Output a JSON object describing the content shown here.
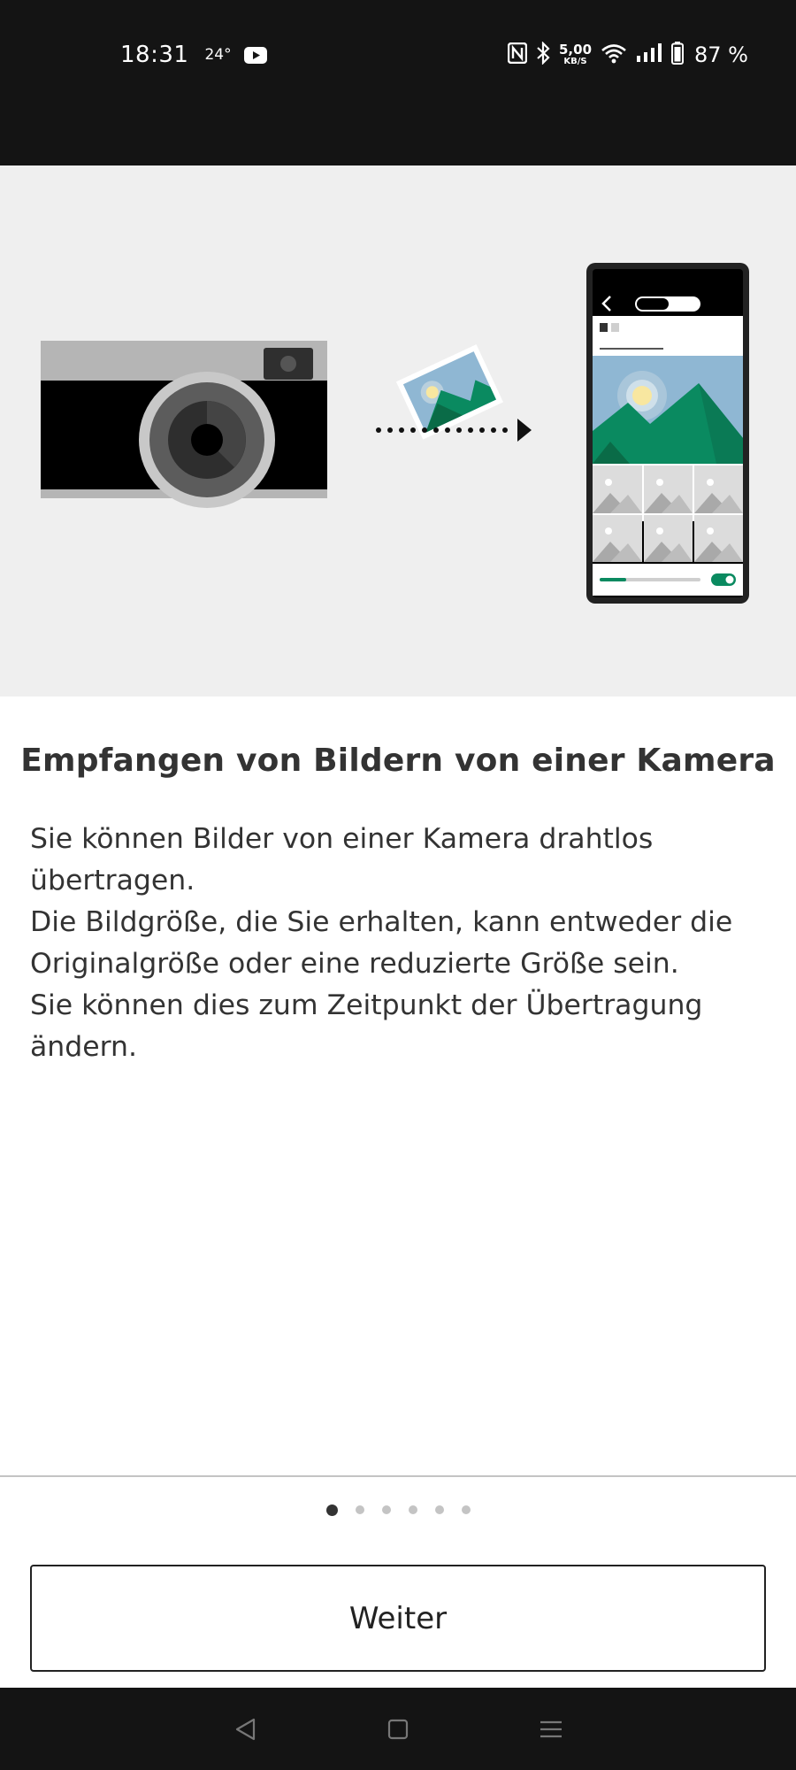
{
  "status_bar": {
    "time": "18:31",
    "temperature": "24°",
    "network_speed_value": "5,00",
    "network_speed_unit": "KB/S",
    "battery_percent": "87 %",
    "icons": [
      "youtube-icon",
      "nfc-icon",
      "bluetooth-icon",
      "wifi-icon",
      "signal-icon",
      "battery-icon"
    ]
  },
  "hero": {
    "illustration": "camera-to-phone-transfer",
    "colors": {
      "accent_green": "#0a8a60",
      "dark_green": "#0a6b47",
      "sky_blue": "#8fb7d3",
      "sun": "#f8e7a0"
    }
  },
  "main": {
    "title": "Empfangen von Bildern von einer Kamera",
    "paragraphs": [
      "Sie können Bilder von einer Kamera drahtlos übertragen.",
      "Die Bildgröße, die Sie erhalten, kann entweder die Originalgröße oder eine reduzierte Größe sein.",
      "Sie können dies zum Zeitpunkt der Übertragung ändern."
    ]
  },
  "pagination": {
    "total": 6,
    "current": 1
  },
  "footer": {
    "next_label": "Weiter"
  },
  "nav_bar": {
    "icons": [
      "back-icon",
      "home-icon",
      "recents-icon"
    ]
  }
}
